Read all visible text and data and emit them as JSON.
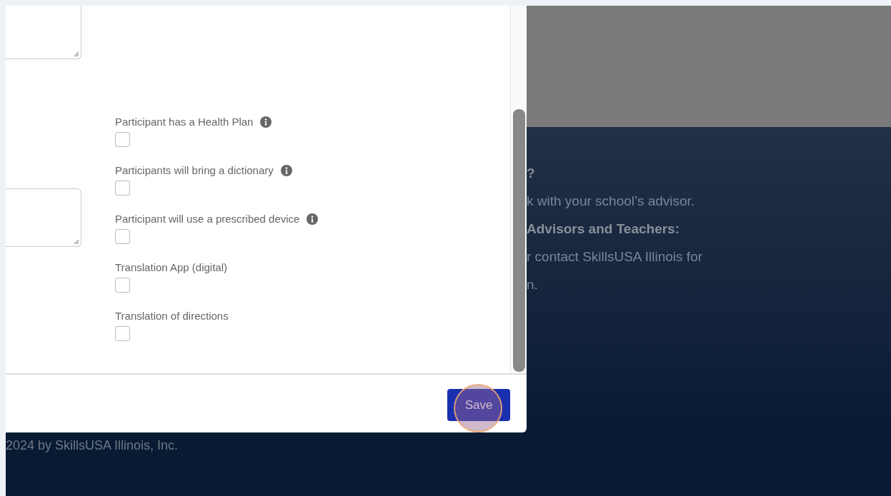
{
  "modal": {
    "checkboxes": [
      {
        "label": "Participant has a Health Plan",
        "info": true,
        "checked": false
      },
      {
        "label": "Participants will bring a dictionary",
        "info": true,
        "checked": false
      },
      {
        "label": "Participant will use a prescribed device",
        "info": true,
        "checked": false
      },
      {
        "label": "Translation App (digital)",
        "info": false,
        "checked": false
      },
      {
        "label": "Translation of directions",
        "info": false,
        "checked": false
      }
    ],
    "save_button": "Save"
  },
  "page": {
    "lines": [
      {
        "text": "?",
        "bold": true
      },
      {
        "text": "k with your school’s advisor.",
        "bold": false
      },
      {
        "text": "Advisors and Teachers:",
        "bold": true
      },
      {
        "text": "r contact SkillsUSA Illinois for",
        "bold": false
      },
      {
        "text": "n.",
        "bold": false
      }
    ],
    "copyright": "2024 by SkillsUSA Illinois, Inc."
  }
}
